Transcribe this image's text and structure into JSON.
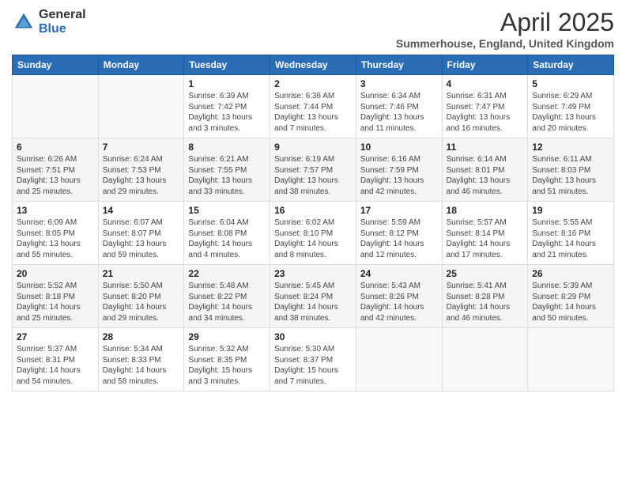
{
  "header": {
    "logo_general": "General",
    "logo_blue": "Blue",
    "month": "April 2025",
    "location": "Summerhouse, England, United Kingdom"
  },
  "weekdays": [
    "Sunday",
    "Monday",
    "Tuesday",
    "Wednesday",
    "Thursday",
    "Friday",
    "Saturday"
  ],
  "weeks": [
    [
      {
        "day": "",
        "info": ""
      },
      {
        "day": "",
        "info": ""
      },
      {
        "day": "1",
        "info": "Sunrise: 6:39 AM\nSunset: 7:42 PM\nDaylight: 13 hours and 3 minutes."
      },
      {
        "day": "2",
        "info": "Sunrise: 6:36 AM\nSunset: 7:44 PM\nDaylight: 13 hours and 7 minutes."
      },
      {
        "day": "3",
        "info": "Sunrise: 6:34 AM\nSunset: 7:46 PM\nDaylight: 13 hours and 11 minutes."
      },
      {
        "day": "4",
        "info": "Sunrise: 6:31 AM\nSunset: 7:47 PM\nDaylight: 13 hours and 16 minutes."
      },
      {
        "day": "5",
        "info": "Sunrise: 6:29 AM\nSunset: 7:49 PM\nDaylight: 13 hours and 20 minutes."
      }
    ],
    [
      {
        "day": "6",
        "info": "Sunrise: 6:26 AM\nSunset: 7:51 PM\nDaylight: 13 hours and 25 minutes."
      },
      {
        "day": "7",
        "info": "Sunrise: 6:24 AM\nSunset: 7:53 PM\nDaylight: 13 hours and 29 minutes."
      },
      {
        "day": "8",
        "info": "Sunrise: 6:21 AM\nSunset: 7:55 PM\nDaylight: 13 hours and 33 minutes."
      },
      {
        "day": "9",
        "info": "Sunrise: 6:19 AM\nSunset: 7:57 PM\nDaylight: 13 hours and 38 minutes."
      },
      {
        "day": "10",
        "info": "Sunrise: 6:16 AM\nSunset: 7:59 PM\nDaylight: 13 hours and 42 minutes."
      },
      {
        "day": "11",
        "info": "Sunrise: 6:14 AM\nSunset: 8:01 PM\nDaylight: 13 hours and 46 minutes."
      },
      {
        "day": "12",
        "info": "Sunrise: 6:11 AM\nSunset: 8:03 PM\nDaylight: 13 hours and 51 minutes."
      }
    ],
    [
      {
        "day": "13",
        "info": "Sunrise: 6:09 AM\nSunset: 8:05 PM\nDaylight: 13 hours and 55 minutes."
      },
      {
        "day": "14",
        "info": "Sunrise: 6:07 AM\nSunset: 8:07 PM\nDaylight: 13 hours and 59 minutes."
      },
      {
        "day": "15",
        "info": "Sunrise: 6:04 AM\nSunset: 8:08 PM\nDaylight: 14 hours and 4 minutes."
      },
      {
        "day": "16",
        "info": "Sunrise: 6:02 AM\nSunset: 8:10 PM\nDaylight: 14 hours and 8 minutes."
      },
      {
        "day": "17",
        "info": "Sunrise: 5:59 AM\nSunset: 8:12 PM\nDaylight: 14 hours and 12 minutes."
      },
      {
        "day": "18",
        "info": "Sunrise: 5:57 AM\nSunset: 8:14 PM\nDaylight: 14 hours and 17 minutes."
      },
      {
        "day": "19",
        "info": "Sunrise: 5:55 AM\nSunset: 8:16 PM\nDaylight: 14 hours and 21 minutes."
      }
    ],
    [
      {
        "day": "20",
        "info": "Sunrise: 5:52 AM\nSunset: 8:18 PM\nDaylight: 14 hours and 25 minutes."
      },
      {
        "day": "21",
        "info": "Sunrise: 5:50 AM\nSunset: 8:20 PM\nDaylight: 14 hours and 29 minutes."
      },
      {
        "day": "22",
        "info": "Sunrise: 5:48 AM\nSunset: 8:22 PM\nDaylight: 14 hours and 34 minutes."
      },
      {
        "day": "23",
        "info": "Sunrise: 5:45 AM\nSunset: 8:24 PM\nDaylight: 14 hours and 38 minutes."
      },
      {
        "day": "24",
        "info": "Sunrise: 5:43 AM\nSunset: 8:26 PM\nDaylight: 14 hours and 42 minutes."
      },
      {
        "day": "25",
        "info": "Sunrise: 5:41 AM\nSunset: 8:28 PM\nDaylight: 14 hours and 46 minutes."
      },
      {
        "day": "26",
        "info": "Sunrise: 5:39 AM\nSunset: 8:29 PM\nDaylight: 14 hours and 50 minutes."
      }
    ],
    [
      {
        "day": "27",
        "info": "Sunrise: 5:37 AM\nSunset: 8:31 PM\nDaylight: 14 hours and 54 minutes."
      },
      {
        "day": "28",
        "info": "Sunrise: 5:34 AM\nSunset: 8:33 PM\nDaylight: 14 hours and 58 minutes."
      },
      {
        "day": "29",
        "info": "Sunrise: 5:32 AM\nSunset: 8:35 PM\nDaylight: 15 hours and 3 minutes."
      },
      {
        "day": "30",
        "info": "Sunrise: 5:30 AM\nSunset: 8:37 PM\nDaylight: 15 hours and 7 minutes."
      },
      {
        "day": "",
        "info": ""
      },
      {
        "day": "",
        "info": ""
      },
      {
        "day": "",
        "info": ""
      }
    ]
  ]
}
